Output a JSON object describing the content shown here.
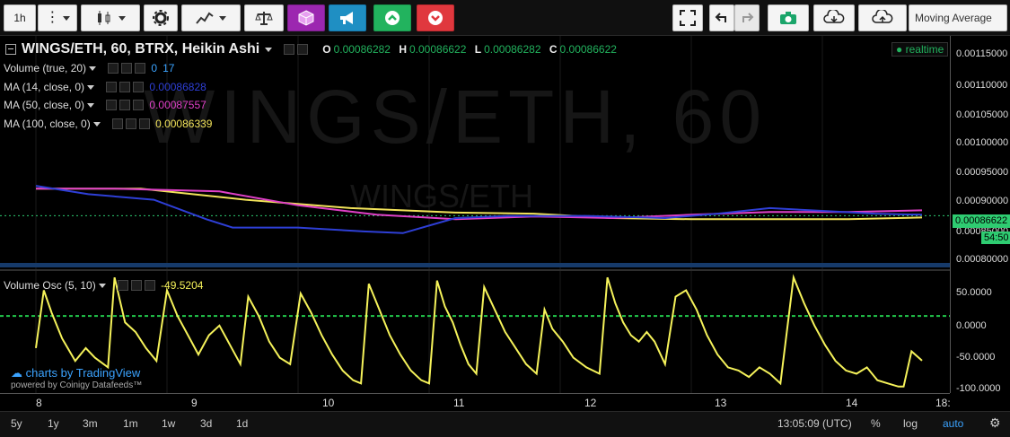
{
  "toolbar": {
    "interval": "1h",
    "indicator_dropdown": "Moving Average"
  },
  "symbol": {
    "title": "WINGS/ETH, 60, BTRX, Heikin Ashi",
    "open_label": "O",
    "open": "0.00086282",
    "high_label": "H",
    "high": "0.00086622",
    "low_label": "L",
    "low": "0.00086282",
    "close_label": "C",
    "close": "0.00086622",
    "realtime": "realtime",
    "watermark": "WINGS/ETH, 60",
    "watermark_sub": "WINGS/ETH"
  },
  "indicators": [
    {
      "label": "Volume (true, 20)",
      "value_a": "0",
      "value_b": "17",
      "color": "#3ba3ff"
    },
    {
      "label": "MA (14, close, 0)",
      "value": "0.00086828",
      "color": "#2e3fd6"
    },
    {
      "label": "MA (50, close, 0)",
      "value": "0.00087557",
      "color": "#e040c8"
    },
    {
      "label": "MA (100, close, 0)",
      "value": "0.00086339",
      "color": "#f2e35a"
    }
  ],
  "osc": {
    "label": "Volume Osc (5, 10)",
    "value": "-49.5204",
    "color": "#f5f25a"
  },
  "price_axis": {
    "labels": [
      "0.00115000",
      "0.00110000",
      "0.00105000",
      "0.00100000",
      "0.00095000",
      "0.00090000",
      "0.00085000",
      "0.00080000"
    ],
    "current_price": "0.00086622",
    "countdown": "54:50"
  },
  "osc_axis": {
    "labels": [
      "50.0000",
      "0.0000",
      "-50.0000",
      "-100.0000"
    ]
  },
  "time_axis": {
    "labels": [
      "8",
      "9",
      "10",
      "11",
      "12",
      "13",
      "14",
      "18:"
    ]
  },
  "bottom_bar": {
    "ranges": [
      "5y",
      "1y",
      "3m",
      "1m",
      "1w",
      "3d",
      "1d"
    ],
    "clock": "13:05:09 (UTC)",
    "percent": "%",
    "log": "log",
    "auto": "auto"
  },
  "branding": {
    "line1": "charts by TradingView",
    "line2": "powered by Coinigy Datafeeds™"
  },
  "chart_data": {
    "type": "line",
    "x_ticks": [
      "8",
      "9",
      "10",
      "11",
      "12",
      "13",
      "14"
    ],
    "y_range": [
      0.00077,
      0.00119
    ],
    "osc_range": [
      -100,
      90
    ],
    "osc_threshold": 20,
    "volume_osc": [
      [
        0.0,
        -30
      ],
      [
        0.06,
        60
      ],
      [
        0.12,
        25
      ],
      [
        0.2,
        -15
      ],
      [
        0.3,
        -50
      ],
      [
        0.38,
        -30
      ],
      [
        0.45,
        -45
      ],
      [
        0.55,
        -60
      ],
      [
        0.6,
        80
      ],
      [
        0.68,
        10
      ],
      [
        0.76,
        -5
      ],
      [
        0.84,
        -30
      ],
      [
        0.92,
        -50
      ],
      [
        1.0,
        60
      ],
      [
        1.08,
        20
      ],
      [
        1.16,
        -10
      ],
      [
        1.24,
        -40
      ],
      [
        1.32,
        -10
      ],
      [
        1.4,
        5
      ],
      [
        1.48,
        -25
      ],
      [
        1.56,
        -55
      ],
      [
        1.62,
        50
      ],
      [
        1.7,
        20
      ],
      [
        1.78,
        -20
      ],
      [
        1.86,
        -45
      ],
      [
        1.94,
        -55
      ],
      [
        2.02,
        55
      ],
      [
        2.1,
        25
      ],
      [
        2.18,
        -10
      ],
      [
        2.26,
        -40
      ],
      [
        2.34,
        -65
      ],
      [
        2.42,
        -80
      ],
      [
        2.48,
        -85
      ],
      [
        2.54,
        70
      ],
      [
        2.62,
        30
      ],
      [
        2.7,
        -10
      ],
      [
        2.78,
        -40
      ],
      [
        2.86,
        -65
      ],
      [
        2.94,
        -80
      ],
      [
        3.0,
        -85
      ],
      [
        3.06,
        75
      ],
      [
        3.12,
        35
      ],
      [
        3.18,
        10
      ],
      [
        3.24,
        -25
      ],
      [
        3.3,
        -55
      ],
      [
        3.36,
        -70
      ],
      [
        3.42,
        65
      ],
      [
        3.5,
        30
      ],
      [
        3.58,
        -5
      ],
      [
        3.66,
        -30
      ],
      [
        3.74,
        -55
      ],
      [
        3.82,
        -70
      ],
      [
        3.88,
        30
      ],
      [
        3.94,
        0
      ],
      [
        4.02,
        -20
      ],
      [
        4.1,
        -45
      ],
      [
        4.2,
        -60
      ],
      [
        4.3,
        -70
      ],
      [
        4.36,
        80
      ],
      [
        4.42,
        40
      ],
      [
        4.48,
        10
      ],
      [
        4.54,
        -10
      ],
      [
        4.6,
        -20
      ],
      [
        4.66,
        -5
      ],
      [
        4.72,
        -20
      ],
      [
        4.8,
        -55
      ],
      [
        4.88,
        50
      ],
      [
        4.96,
        60
      ],
      [
        5.04,
        30
      ],
      [
        5.12,
        -10
      ],
      [
        5.2,
        -40
      ],
      [
        5.28,
        -60
      ],
      [
        5.36,
        -65
      ],
      [
        5.44,
        -75
      ],
      [
        5.52,
        -60
      ],
      [
        5.6,
        -70
      ],
      [
        5.68,
        -85
      ],
      [
        5.78,
        80
      ],
      [
        5.86,
        40
      ],
      [
        5.94,
        5
      ],
      [
        6.02,
        -25
      ],
      [
        6.1,
        -50
      ],
      [
        6.18,
        -65
      ],
      [
        6.26,
        -70
      ],
      [
        6.34,
        -60
      ],
      [
        6.42,
        -80
      ],
      [
        6.5,
        -85
      ],
      [
        6.58,
        -90
      ],
      [
        6.62,
        -90
      ],
      [
        6.68,
        -35
      ],
      [
        6.76,
        -49.5
      ]
    ],
    "ma14": [
      [
        0.0,
        0.00092
      ],
      [
        0.4,
        0.000905
      ],
      [
        0.9,
        0.000895
      ],
      [
        1.3,
        0.00086
      ],
      [
        1.5,
        0.000845
      ],
      [
        2.0,
        0.000845
      ],
      [
        2.5,
        0.000838
      ],
      [
        2.8,
        0.000835
      ],
      [
        3.2,
        0.000862
      ],
      [
        3.6,
        0.000866
      ],
      [
        4.2,
        0.000866
      ],
      [
        4.8,
        0.000862
      ],
      [
        5.2,
        0.00087
      ],
      [
        5.6,
        0.00088
      ],
      [
        6.0,
        0.000875
      ],
      [
        6.4,
        0.00087
      ],
      [
        6.76,
        0.000868
      ]
    ],
    "ma50": [
      [
        0.0,
        0.000915
      ],
      [
        0.6,
        0.000915
      ],
      [
        1.4,
        0.00091
      ],
      [
        2.0,
        0.000885
      ],
      [
        2.6,
        0.000868
      ],
      [
        3.2,
        0.00086
      ],
      [
        3.8,
        0.000865
      ],
      [
        4.4,
        0.000862
      ],
      [
        5.0,
        0.000868
      ],
      [
        5.6,
        0.000873
      ],
      [
        6.2,
        0.000873
      ],
      [
        6.76,
        0.000876
      ]
    ],
    "ma100": [
      [
        0.0,
        0.000915
      ],
      [
        0.8,
        0.000915
      ],
      [
        1.6,
        0.000895
      ],
      [
        2.4,
        0.00088
      ],
      [
        3.2,
        0.000872
      ],
      [
        3.8,
        0.00087
      ],
      [
        4.4,
        0.000862
      ],
      [
        5.0,
        0.00086
      ],
      [
        5.6,
        0.00086
      ],
      [
        6.2,
        0.00086
      ],
      [
        6.76,
        0.000863
      ]
    ]
  }
}
